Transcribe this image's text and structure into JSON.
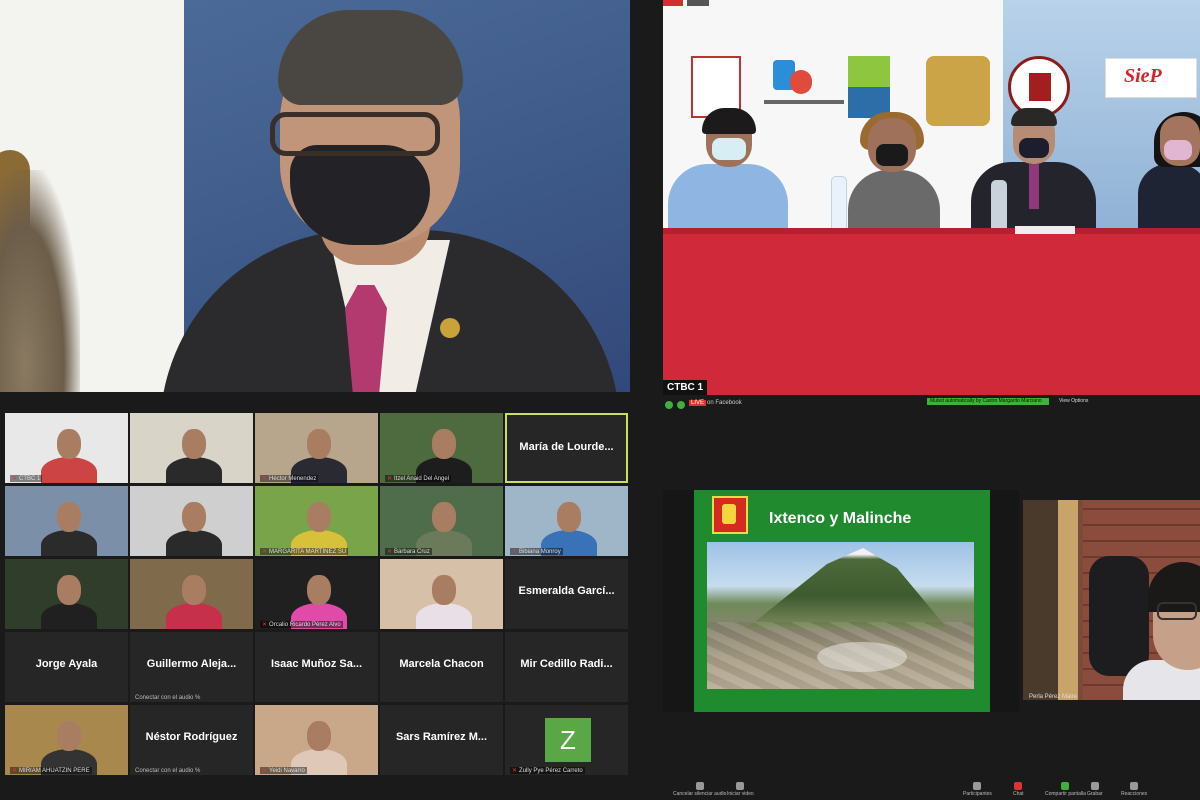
{
  "meeting": {
    "main_view_label": "CTBC 1",
    "live_badge": "LIVE",
    "live_destination": "on Facebook",
    "recording_banner": "Muted automatically by Castro Margarito Marciano",
    "view_menu": "View Options"
  },
  "presentation": {
    "slide_title": "Ixtenco y Malinche"
  },
  "gallery": [
    {
      "type": "video",
      "caption": "CTBC 1"
    },
    {
      "type": "video",
      "caption": ""
    },
    {
      "type": "video",
      "caption": "Héctor Menendez"
    },
    {
      "type": "video",
      "caption": "Itzel Anaid Del Angel"
    },
    {
      "type": "name",
      "name": "María de Lourde...",
      "active": true
    },
    {
      "type": "video",
      "caption": ""
    },
    {
      "type": "video",
      "caption": ""
    },
    {
      "type": "video",
      "caption": "MARGARITA MARTINEZ SU"
    },
    {
      "type": "video",
      "caption": "Bárbara Cruz"
    },
    {
      "type": "video",
      "caption": "Bibiana Monroy"
    },
    {
      "type": "video",
      "caption": ""
    },
    {
      "type": "video",
      "caption": ""
    },
    {
      "type": "video",
      "caption": "Orcalio Ricardo Pérez Alvo"
    },
    {
      "type": "video",
      "caption": ""
    },
    {
      "type": "name",
      "name": "Esmeralda Garcí..."
    },
    {
      "type": "name",
      "name": "Jorge Ayala"
    },
    {
      "type": "name",
      "name": "Guillermo Aleja...",
      "sub": "Conectar con el audio %"
    },
    {
      "type": "name",
      "name": "Isaac Muñoz Sa..."
    },
    {
      "type": "name",
      "name": "Marcela Chacon"
    },
    {
      "type": "name",
      "name": "Mir Cedillo Radi..."
    },
    {
      "type": "video",
      "caption": "MIRIAM AHUATZIN PERE"
    },
    {
      "type": "name",
      "name": "Néstor Rodríguez",
      "sub": "Conectar con el audio %"
    },
    {
      "type": "video",
      "caption": "Yeidi Navarro"
    },
    {
      "type": "name",
      "name": "Sars Ramírez M..."
    },
    {
      "type": "avatar",
      "letter": "Z",
      "caption": "Zully Pye Pérez Carreto"
    }
  ],
  "webcam_caption": "Perla Pérez Maire",
  "toolbar": [
    {
      "label": "Cancelar silenciar audio",
      "style": "default"
    },
    {
      "label": "Iniciar video",
      "style": "default"
    },
    {
      "label": "Participantes",
      "style": "default"
    },
    {
      "label": "Chat",
      "style": "red"
    },
    {
      "label": "Compartir pantalla",
      "style": "green"
    },
    {
      "label": "Grabar",
      "style": "default"
    },
    {
      "label": "Reacciones",
      "style": "default"
    }
  ],
  "colors": {
    "active_border": "#c8e05a",
    "slide_bg": "#1f8a2e",
    "table_red": "#d02a3a",
    "avatar_green": "#5aa845"
  }
}
